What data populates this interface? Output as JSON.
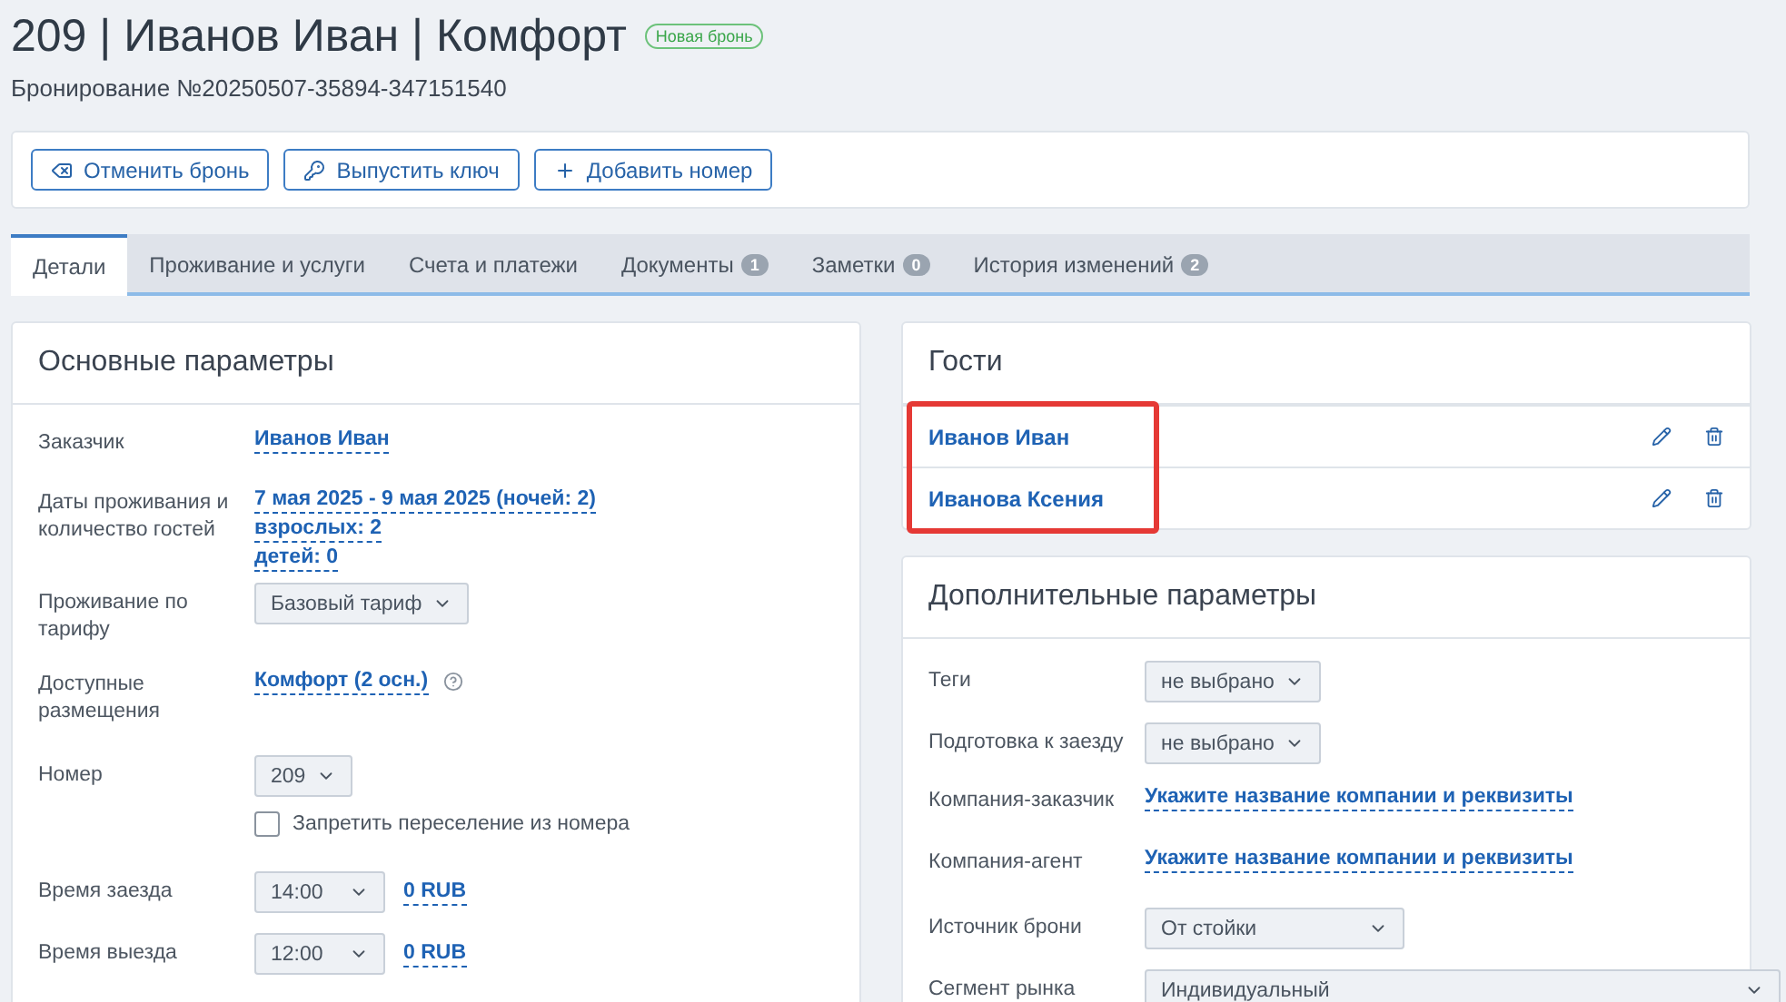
{
  "header": {
    "title": "209 | Иванов Иван | Комфорт",
    "status_badge": "Новая бронь",
    "booking_number": "Бронирование №20250507-35894-347151540"
  },
  "toolbar": [
    {
      "kind": "cancel",
      "label": "Отменить бронь"
    },
    {
      "kind": "key",
      "label": "Выпустить ключ"
    },
    {
      "kind": "add",
      "label": "Добавить номер"
    }
  ],
  "tabs": [
    {
      "label": "Детали",
      "selected": true
    },
    {
      "label": "Проживание и услуги",
      "selected": false
    },
    {
      "label": "Счета и платежи",
      "selected": false
    },
    {
      "label": "Документы",
      "count": "1",
      "selected": false
    },
    {
      "label": "Заметки",
      "count": "0",
      "selected": false
    },
    {
      "label": "История изменений",
      "count": "2",
      "selected": false
    }
  ],
  "main_params": {
    "title": "Основные параметры",
    "rows": [
      {
        "kind": "link",
        "label": "Заказчик",
        "values": [
          "Иванов Иван"
        ]
      },
      {
        "kind": "link",
        "label": "Даты проживания и количество гостей",
        "values": [
          "7 мая 2025 - 9 мая 2025 (ночей: 2)",
          "взрослых: 2",
          "детей: 0"
        ]
      },
      {
        "kind": "select",
        "label": "Проживание по тарифу",
        "value": "Базовый тариф"
      },
      {
        "kind": "link",
        "label": "Доступные размещения",
        "values": [
          "Комфорт (2 осн.)"
        ],
        "help": true
      },
      {
        "kind": "select",
        "label": "Номер",
        "value": "209",
        "checkbox": {
          "label": "Запретить переселение из номера",
          "checked": false
        }
      },
      {
        "kind": "select_time",
        "label": "Время заезда",
        "value": "14:00",
        "price": "0 RUB"
      },
      {
        "kind": "select_time",
        "label": "Время выезда",
        "value": "12:00",
        "price": "0 RUB"
      }
    ]
  },
  "guests": {
    "title": "Гости",
    "highlighted": true,
    "items": [
      {
        "name": "Иванов Иван"
      },
      {
        "name": "Иванова Ксения"
      }
    ]
  },
  "extra_params": {
    "title": "Дополнительные параметры",
    "rows": [
      {
        "kind": "select",
        "label": "Теги",
        "value": "не выбрано"
      },
      {
        "kind": "select",
        "label": "Подготовка к заезду",
        "value": "не выбрано"
      },
      {
        "kind": "link",
        "label": "Компания-заказчик",
        "values": [
          "Укажите название компании и реквизиты"
        ]
      },
      {
        "kind": "link",
        "label": "Компания-агент",
        "values": [
          "Укажите название компании и реквизиты"
        ]
      },
      {
        "kind": "select_wide",
        "label": "Источник брони",
        "value": "От стойки"
      },
      {
        "kind": "select_full",
        "label": "Сегмент рынка",
        "value": "Индивидуальный"
      }
    ]
  }
}
